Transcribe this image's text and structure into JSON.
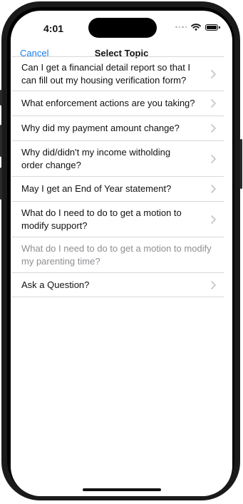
{
  "status": {
    "time": "4:01"
  },
  "nav": {
    "cancel_label": "Cancel",
    "title": "Select Topic"
  },
  "topics": [
    {
      "label": "Can I get a financial detail report so that I can fill out my housing verification form?",
      "enabled": true
    },
    {
      "label": "What enforcement actions are you taking?",
      "enabled": true
    },
    {
      "label": "Why did my payment amount change?",
      "enabled": true
    },
    {
      "label": "Why did/didn't my income witholding order change?",
      "enabled": true
    },
    {
      "label": "May I get an End of Year statement?",
      "enabled": true
    },
    {
      "label": "What do I need to do to get a motion to modify support?",
      "enabled": true
    },
    {
      "label": "What do I need to do to get a motion to modify my parenting time?",
      "enabled": false
    },
    {
      "label": "Ask a Question?",
      "enabled": true
    }
  ],
  "colors": {
    "accent": "#1a7ef0",
    "disabled_text": "#8e8e93",
    "separator": "#d8d8d8"
  }
}
